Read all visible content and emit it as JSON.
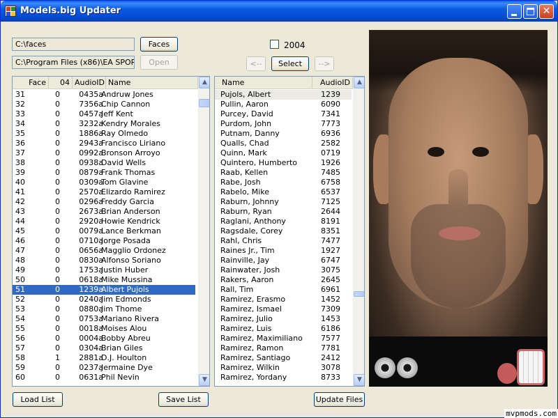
{
  "window": {
    "title": "Models.big Updater"
  },
  "top": {
    "faces_path": "C:\\faces",
    "game_path": "C:\\Program Files (x86)\\EA SPORTS",
    "faces_button": "Faces",
    "open_button": "Open",
    "checkbox_label": "2004",
    "prev_button": "<--",
    "select_button": "Select",
    "next_button": "-->"
  },
  "left_list": {
    "headers": {
      "face": "Face",
      "col04": "04",
      "audio": "AudioID",
      "name": "Name"
    },
    "rows": [
      {
        "face": "31",
        "v04": "0",
        "audio": "0435a",
        "name": "Andruw Jones"
      },
      {
        "face": "32",
        "v04": "0",
        "audio": "7356a",
        "name": "Chip Cannon"
      },
      {
        "face": "33",
        "v04": "0",
        "audio": "0457a",
        "name": "Jeff Kent"
      },
      {
        "face": "34",
        "v04": "0",
        "audio": "3232a",
        "name": "Kendry Morales"
      },
      {
        "face": "35",
        "v04": "0",
        "audio": "1886a",
        "name": "Ray Olmedo"
      },
      {
        "face": "36",
        "v04": "0",
        "audio": "2943a",
        "name": "Francisco Liriano"
      },
      {
        "face": "37",
        "v04": "0",
        "audio": "0992a",
        "name": "Bronson Arroyo"
      },
      {
        "face": "38",
        "v04": "0",
        "audio": "0938a",
        "name": "David Wells"
      },
      {
        "face": "39",
        "v04": "0",
        "audio": "0879a",
        "name": "Frank Thomas"
      },
      {
        "face": "40",
        "v04": "0",
        "audio": "0309a",
        "name": "Tom Glavine"
      },
      {
        "face": "41",
        "v04": "0",
        "audio": "2570a",
        "name": "Elizardo Ramirez"
      },
      {
        "face": "42",
        "v04": "0",
        "audio": "0296a",
        "name": "Freddy Garcia"
      },
      {
        "face": "43",
        "v04": "0",
        "audio": "2673a",
        "name": "Brian Anderson"
      },
      {
        "face": "44",
        "v04": "0",
        "audio": "2920a",
        "name": "Howie Kendrick"
      },
      {
        "face": "45",
        "v04": "0",
        "audio": "0079a",
        "name": "Lance Berkman"
      },
      {
        "face": "46",
        "v04": "0",
        "audio": "0710a",
        "name": "Jorge Posada"
      },
      {
        "face": "47",
        "v04": "0",
        "audio": "0656a",
        "name": "Magglio Ordonez"
      },
      {
        "face": "48",
        "v04": "0",
        "audio": "0830a",
        "name": "Alfonso Soriano"
      },
      {
        "face": "49",
        "v04": "0",
        "audio": "1753a",
        "name": "Justin Huber"
      },
      {
        "face": "50",
        "v04": "0",
        "audio": "0618a",
        "name": "Mike Mussina"
      },
      {
        "face": "51",
        "v04": "0",
        "audio": "1239a",
        "name": "Albert Pujols"
      },
      {
        "face": "52",
        "v04": "0",
        "audio": "0240a",
        "name": "Jim Edmonds"
      },
      {
        "face": "53",
        "v04": "0",
        "audio": "0880a",
        "name": "Jim Thome"
      },
      {
        "face": "54",
        "v04": "0",
        "audio": "0753a",
        "name": "Mariano Rivera"
      },
      {
        "face": "55",
        "v04": "0",
        "audio": "0018a",
        "name": "Moises Alou"
      },
      {
        "face": "56",
        "v04": "0",
        "audio": "0004a",
        "name": "Bobby Abreu"
      },
      {
        "face": "57",
        "v04": "0",
        "audio": "0304a",
        "name": "Brian Giles"
      },
      {
        "face": "58",
        "v04": "1",
        "audio": "2881a",
        "name": "D.J. Houlton"
      },
      {
        "face": "59",
        "v04": "0",
        "audio": "0237a",
        "name": "Jermaine Dye"
      },
      {
        "face": "60",
        "v04": "0",
        "audio": "0631a",
        "name": "Phil Nevin"
      }
    ],
    "selected_index": 20
  },
  "right_list": {
    "headers": {
      "name": "Name",
      "audio": "AudioID"
    },
    "rows": [
      {
        "name": "Pujols, Albert",
        "audio": "1239"
      },
      {
        "name": "Pullin, Aaron",
        "audio": "6090"
      },
      {
        "name": "Purcey, David",
        "audio": "7341"
      },
      {
        "name": "Purdom, John",
        "audio": "7773"
      },
      {
        "name": "Putnam, Danny",
        "audio": "6936"
      },
      {
        "name": "Qualls, Chad",
        "audio": "2582"
      },
      {
        "name": "Quinn, Mark",
        "audio": "0719"
      },
      {
        "name": "Quintero, Humberto",
        "audio": "1926"
      },
      {
        "name": "Raab, Kellen",
        "audio": "7485"
      },
      {
        "name": "Rabe, Josh",
        "audio": "6758"
      },
      {
        "name": "Rabelo, Mike",
        "audio": "6537"
      },
      {
        "name": "Raburn, Johnny",
        "audio": "7125"
      },
      {
        "name": "Raburn, Ryan",
        "audio": "2644"
      },
      {
        "name": "Raglani, Anthony",
        "audio": "8191"
      },
      {
        "name": "Ragsdale, Corey",
        "audio": "8351"
      },
      {
        "name": "Rahl, Chris",
        "audio": "7477"
      },
      {
        "name": "Raines Jr., Tim",
        "audio": "1927"
      },
      {
        "name": "Rainville, Jay",
        "audio": "6747"
      },
      {
        "name": "Rainwater, Josh",
        "audio": "3075"
      },
      {
        "name": "Rakers, Aaron",
        "audio": "2645"
      },
      {
        "name": "Rall, Tim",
        "audio": "6961"
      },
      {
        "name": "Ramirez, Erasmo",
        "audio": "1452"
      },
      {
        "name": "Ramirez, Ismael",
        "audio": "7309"
      },
      {
        "name": "Ramirez, Julio",
        "audio": "1453"
      },
      {
        "name": "Ramirez, Luis",
        "audio": "6186"
      },
      {
        "name": "Ramirez, Maximiliano",
        "audio": "7577"
      },
      {
        "name": "Ramirez, Ramon",
        "audio": "7781"
      },
      {
        "name": "Ramirez, Santiago",
        "audio": "2412"
      },
      {
        "name": "Ramirez, Wilkin",
        "audio": "3078"
      },
      {
        "name": "Ramirez, Yordany",
        "audio": "8733"
      }
    ],
    "highlighted_index": 0
  },
  "bottom": {
    "load_list": "Load List",
    "save_list": "Save List",
    "update_files": "Update Files"
  },
  "watermark": "mvpmods.com"
}
